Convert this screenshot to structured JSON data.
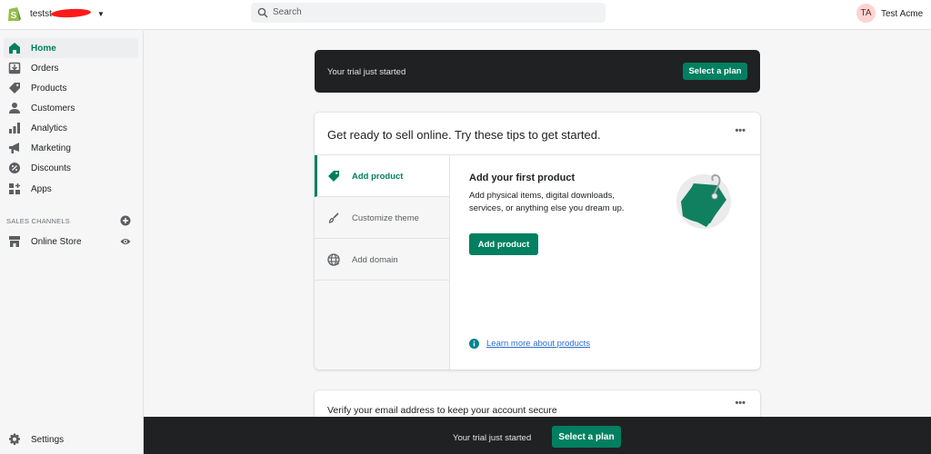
{
  "topbar": {
    "store_name": "testst",
    "search_placeholder": "Search",
    "user_initials": "TA",
    "user_name": "Test Acme"
  },
  "sidebar": {
    "items": [
      {
        "label": "Home",
        "icon": "home-icon",
        "active": true
      },
      {
        "label": "Orders",
        "icon": "orders-icon"
      },
      {
        "label": "Products",
        "icon": "tag-icon"
      },
      {
        "label": "Customers",
        "icon": "person-icon"
      },
      {
        "label": "Analytics",
        "icon": "bar-chart-icon"
      },
      {
        "label": "Marketing",
        "icon": "megaphone-icon"
      },
      {
        "label": "Discounts",
        "icon": "discount-icon"
      },
      {
        "label": "Apps",
        "icon": "apps-icon"
      }
    ],
    "sales_channels_label": "SALES CHANNELS",
    "online_store_label": "Online Store",
    "settings_label": "Settings"
  },
  "trial_banner": {
    "text": "Your trial just started",
    "button": "Select a plan"
  },
  "tips_card": {
    "title": "Get ready to sell online. Try these tips to get started.",
    "more": "•••",
    "tabs": [
      {
        "label": "Add product",
        "icon": "tag-icon",
        "active": true
      },
      {
        "label": "Customize theme",
        "icon": "brush-icon"
      },
      {
        "label": "Add domain",
        "icon": "globe-icon"
      }
    ],
    "content": {
      "title": "Add your first product",
      "description": "Add physical items, digital downloads, services, or anything else you dream up.",
      "button": "Add product",
      "learn_more": "Learn more about products"
    }
  },
  "verify_card": {
    "title": "Verify your email address to keep your account secure",
    "more": "•••"
  },
  "bottom_bar": {
    "text": "Your trial just started",
    "button": "Select a plan"
  },
  "colors": {
    "accent": "#008060",
    "banner_bg": "#202123",
    "avatar_bg": "#fed3d1",
    "link": "#2c6ecb"
  }
}
